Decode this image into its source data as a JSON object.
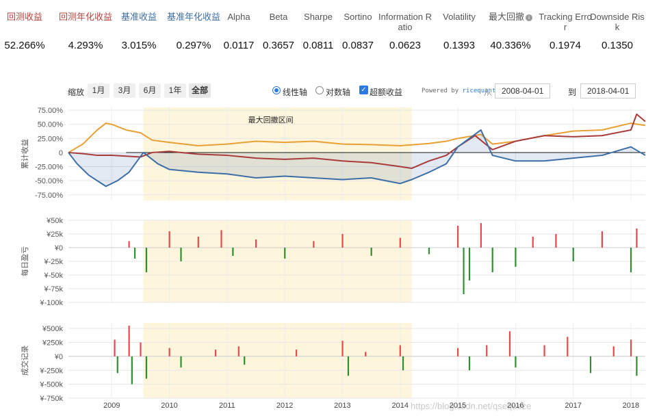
{
  "metrics": [
    {
      "label": "回测收益",
      "value": "52.266%",
      "color": "#b5443f",
      "left": 0,
      "width": 72
    },
    {
      "label": "回测年化收益",
      "value": "4.293%",
      "color": "#b5443f",
      "left": 82,
      "width": 86
    },
    {
      "label": "基准收益",
      "value": "3.015%",
      "color": "#3c6ea5",
      "left": 170,
      "width": 66
    },
    {
      "label": "基准年化收益",
      "value": "0.297%",
      "color": "#3c6ea5",
      "left": 240,
      "width": 86
    },
    {
      "label": "Alpha",
      "value": "0.0117",
      "color": "#555555",
      "left": 322,
      "width": 54
    },
    {
      "label": "Beta",
      "value": "0.3657",
      "color": "#555555",
      "left": 380,
      "width": 54
    },
    {
      "label": "Sharpe",
      "value": "0.0811",
      "color": "#555555",
      "left": 438,
      "width": 54
    },
    {
      "label": "Sortino",
      "value": "0.0837",
      "color": "#555555",
      "left": 496,
      "width": 54
    },
    {
      "label": "Information R\natio",
      "value": "0.0623",
      "color": "#555555",
      "left": 552,
      "width": 80
    },
    {
      "label": "Volatility",
      "value": "0.1393",
      "color": "#555555",
      "left": 636,
      "width": 70
    },
    {
      "label": "最大回撤",
      "value": "40.336%",
      "color": "#555555",
      "left": 708,
      "width": 76,
      "info": true
    },
    {
      "label": "Tracking Erro\nr",
      "value": "0.1974",
      "color": "#555555",
      "left": 786,
      "width": 80
    },
    {
      "label": "Downside Ris\nk",
      "value": "0.1350",
      "color": "#555555",
      "left": 862,
      "width": 80
    }
  ],
  "controls": {
    "zoom_label": "缩放",
    "zoom_buttons": [
      "1月",
      "3月",
      "6月",
      "1年",
      "全部"
    ],
    "axis_linear": "线性轴",
    "axis_log": "对数轴",
    "excess_label": "超额收益",
    "powered_prefix": "Powered by ",
    "powered_brand": "ricequant.com",
    "from_label": "从",
    "from_date": "2008-04-01",
    "to_label": "到",
    "to_date": "2018-04-01"
  },
  "watermark": "https://blog.csdn.net/qsequeze",
  "chart_data": [
    {
      "type": "line",
      "ylabel": "累计收益",
      "ylim": [
        -85,
        80
      ],
      "yticks": [
        75,
        50,
        25,
        0,
        -25,
        -50,
        -75
      ],
      "ytick_labels": [
        "75.00%",
        "50.00%",
        "25.00%",
        "0",
        "-25.00%",
        "-50.00%",
        "-75.00%"
      ],
      "annotation": "最大回撤区间",
      "drawdown_range": [
        2009.55,
        2014.2
      ],
      "xlim": [
        2008.25,
        2018.25
      ],
      "x_labels": [
        "2009",
        "2010",
        "2011",
        "2012",
        "2013",
        "2014",
        "2015",
        "2016",
        "2017",
        "2018"
      ],
      "series": [
        {
          "color": "#e8a033",
          "x": [
            2008.25,
            2008.5,
            2008.75,
            2008.9,
            2009.0,
            2009.25,
            2009.5,
            2009.7,
            2010.0,
            2010.5,
            2011.0,
            2011.5,
            2012.0,
            2012.5,
            2013.0,
            2013.5,
            2014.0,
            2014.5,
            2014.8,
            2015.0,
            2015.4,
            2015.6,
            2016.0,
            2016.5,
            2017.0,
            2017.5,
            2018.0,
            2018.25
          ],
          "values": [
            0,
            15,
            40,
            52,
            50,
            40,
            35,
            22,
            18,
            12,
            15,
            20,
            18,
            20,
            15,
            14,
            12,
            16,
            20,
            25,
            32,
            15,
            20,
            30,
            38,
            40,
            52,
            48
          ]
        },
        {
          "color": "#a83a3a",
          "x": [
            2008.25,
            2008.5,
            2008.75,
            2009.0,
            2009.5,
            2009.7,
            2010.0,
            2010.5,
            2011.0,
            2011.5,
            2012.0,
            2012.5,
            2013.0,
            2013.5,
            2014.0,
            2014.2,
            2014.5,
            2014.8,
            2015.0,
            2015.3,
            2015.6,
            2016.0,
            2016.5,
            2017.0,
            2017.5,
            2018.0,
            2018.1,
            2018.25
          ],
          "values": [
            0,
            -2,
            -5,
            -5,
            -8,
            0,
            2,
            -3,
            -5,
            -10,
            -12,
            -10,
            -15,
            -18,
            -25,
            -28,
            -15,
            -5,
            10,
            30,
            5,
            20,
            30,
            28,
            30,
            40,
            68,
            55
          ]
        },
        {
          "color": "#3c6ea5",
          "x": [
            2008.25,
            2008.4,
            2008.6,
            2008.9,
            2009.1,
            2009.3,
            2009.55,
            2009.8,
            2010.0,
            2010.5,
            2011.0,
            2011.5,
            2012.0,
            2012.5,
            2013.0,
            2013.5,
            2014.0,
            2014.2,
            2014.5,
            2014.8,
            2015.0,
            2015.4,
            2015.6,
            2016.0,
            2016.5,
            2017.0,
            2017.5,
            2018.0,
            2018.25
          ],
          "values": [
            0,
            -20,
            -40,
            -60,
            -50,
            -35,
            0,
            -20,
            -30,
            -35,
            -38,
            -45,
            -42,
            -45,
            -48,
            -45,
            -55,
            -48,
            -35,
            -20,
            10,
            40,
            -5,
            -15,
            -15,
            -10,
            -5,
            10,
            -5
          ]
        }
      ]
    },
    {
      "type": "bar",
      "ylabel": "每日盈亏",
      "ylim": [
        -100000,
        50000
      ],
      "yticks": [
        50000,
        25000,
        0,
        -25000,
        -50000,
        -75000,
        -100000
      ],
      "ytick_labels": [
        "¥50k",
        "¥25k",
        "¥0",
        "¥-25k",
        "¥-50k",
        "¥-75k",
        "¥-100k"
      ],
      "positive_color": "#e4494b",
      "negative_color": "#2f8f2f",
      "bars": [
        {
          "x": 2009.3,
          "value": 12000
        },
        {
          "x": 2009.4,
          "value": -20000
        },
        {
          "x": 2009.6,
          "value": -45000
        },
        {
          "x": 2010.0,
          "value": 30000
        },
        {
          "x": 2010.2,
          "value": -25000
        },
        {
          "x": 2010.5,
          "value": 20000
        },
        {
          "x": 2010.9,
          "value": 32000
        },
        {
          "x": 2011.1,
          "value": -15000
        },
        {
          "x": 2011.5,
          "value": 15000
        },
        {
          "x": 2012.0,
          "value": -20000
        },
        {
          "x": 2012.5,
          "value": 12000
        },
        {
          "x": 2013.0,
          "value": 25000
        },
        {
          "x": 2013.5,
          "value": -15000
        },
        {
          "x": 2014.0,
          "value": 18000
        },
        {
          "x": 2014.5,
          "value": -12000
        },
        {
          "x": 2015.0,
          "value": 40000
        },
        {
          "x": 2015.1,
          "value": -85000
        },
        {
          "x": 2015.2,
          "value": -60000
        },
        {
          "x": 2015.4,
          "value": 45000
        },
        {
          "x": 2015.6,
          "value": -45000
        },
        {
          "x": 2016.0,
          "value": -35000
        },
        {
          "x": 2016.3,
          "value": 20000
        },
        {
          "x": 2016.7,
          "value": 25000
        },
        {
          "x": 2017.0,
          "value": -25000
        },
        {
          "x": 2017.5,
          "value": 30000
        },
        {
          "x": 2018.0,
          "value": -45000
        },
        {
          "x": 2018.1,
          "value": 35000
        }
      ]
    },
    {
      "type": "bar",
      "ylabel": "成交记录",
      "ylim": [
        -750000,
        600000
      ],
      "yticks": [
        500000,
        250000,
        0,
        -250000,
        -500000,
        -750000
      ],
      "ytick_labels": [
        "¥500k",
        "¥250k",
        "¥0",
        "¥-250k",
        "¥-500k",
        "¥-750k"
      ],
      "positive_color": "#e4494b",
      "negative_color": "#2f8f2f",
      "bars": [
        {
          "x": 2009.05,
          "value": 300000
        },
        {
          "x": 2009.1,
          "value": -300000
        },
        {
          "x": 2009.3,
          "value": 550000
        },
        {
          "x": 2009.35,
          "value": -500000
        },
        {
          "x": 2009.5,
          "value": 250000
        },
        {
          "x": 2009.6,
          "value": -400000
        },
        {
          "x": 2010.0,
          "value": 150000
        },
        {
          "x": 2010.2,
          "value": -200000
        },
        {
          "x": 2010.8,
          "value": 120000
        },
        {
          "x": 2011.2,
          "value": 180000
        },
        {
          "x": 2011.3,
          "value": -150000
        },
        {
          "x": 2012.2,
          "value": 120000
        },
        {
          "x": 2013.0,
          "value": 280000
        },
        {
          "x": 2013.1,
          "value": -350000
        },
        {
          "x": 2013.4,
          "value": 80000
        },
        {
          "x": 2014.0,
          "value": 200000
        },
        {
          "x": 2014.05,
          "value": -250000
        },
        {
          "x": 2015.0,
          "value": 150000
        },
        {
          "x": 2015.2,
          "value": -250000
        },
        {
          "x": 2015.5,
          "value": 200000
        },
        {
          "x": 2015.9,
          "value": 450000
        },
        {
          "x": 2016.0,
          "value": -200000
        },
        {
          "x": 2016.5,
          "value": 200000
        },
        {
          "x": 2016.9,
          "value": 350000
        },
        {
          "x": 2017.3,
          "value": -300000
        },
        {
          "x": 2017.7,
          "value": 180000
        },
        {
          "x": 2018.0,
          "value": 300000
        },
        {
          "x": 2018.1,
          "value": -350000
        }
      ]
    }
  ]
}
